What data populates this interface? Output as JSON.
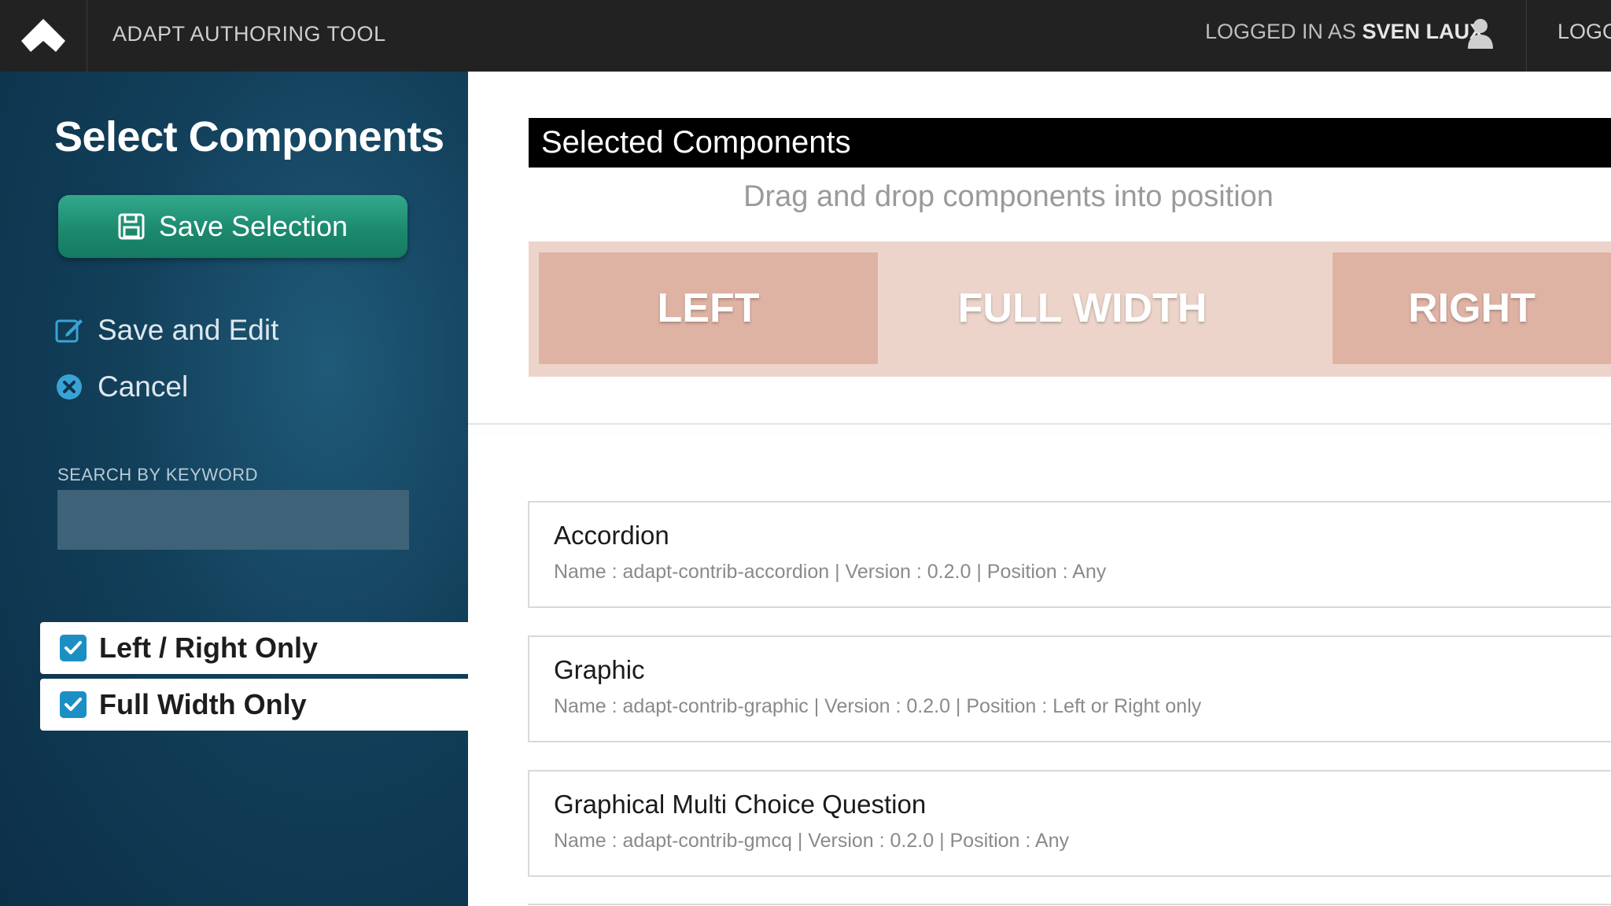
{
  "topbar": {
    "app_title": "ADAPT AUTHORING TOOL",
    "logged_in_prefix": "LOGGED IN AS ",
    "username": "SVEN LAUX",
    "logout_label": "LOGOUT"
  },
  "sidebar": {
    "title": "Select Components",
    "save_selection_label": "Save Selection",
    "save_and_edit_label": "Save and Edit",
    "cancel_label": "Cancel",
    "search_label": "SEARCH BY KEYWORD",
    "search_value": "",
    "filters": [
      {
        "label": "Left / Right Only",
        "checked": true
      },
      {
        "label": "Full Width Only",
        "checked": true
      }
    ]
  },
  "main": {
    "selected_header": "Selected Components",
    "drag_hint": "Drag and drop components into position",
    "zones": {
      "left": "LEFT",
      "full_width": "FULL WIDTH",
      "right": "RIGHT"
    },
    "components": [
      {
        "title": "Accordion",
        "meta": "Name : adapt-contrib-accordion  |  Version : 0.2.0  |  Position : Any"
      },
      {
        "title": "Graphic",
        "meta": "Name : adapt-contrib-graphic  |  Version : 0.2.0  |  Position : Left or Right only"
      },
      {
        "title": "Graphical Multi Choice Question",
        "meta": "Name : adapt-contrib-gmcq  |  Version : 0.2.0  |  Position : Any"
      }
    ]
  },
  "colors": {
    "topbar_bg": "#222222",
    "sidebar_bg": "#123f5a",
    "save_button": "#1c8a6e",
    "checkbox": "#1b8fc4",
    "zone_side": "#deb3a4",
    "zone_bg": "#ecd4ca"
  },
  "icons": {
    "home": "adapt-logo-icon",
    "user": "user-icon",
    "save": "floppy-disk-icon",
    "edit": "edit-icon",
    "cancel": "cancel-circle-icon",
    "checkbox": "checkbox-checked-icon"
  }
}
